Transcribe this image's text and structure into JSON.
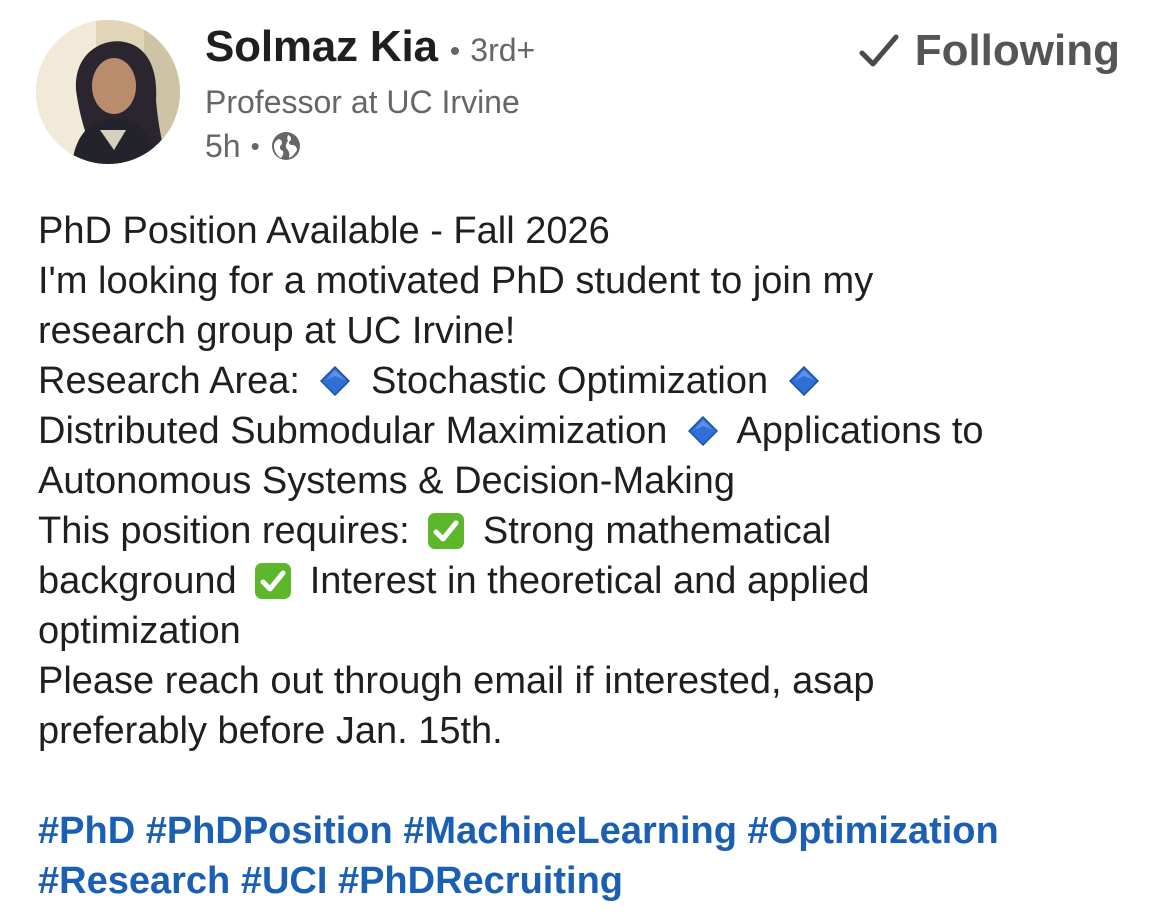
{
  "author": {
    "name": "Solmaz Kia",
    "degree": "3rd+",
    "headline": "Professor at UC Irvine",
    "posted_ago": "5h",
    "visibility_icon": "globe-icon"
  },
  "follow_button": {
    "label": "Following",
    "icon": "checkmark-icon"
  },
  "post": {
    "title": "PhD Position Available - Fall 2026",
    "intro_line1": "I'm looking for a motivated PhD student to join my",
    "intro_line2": "research group at UC Irvine!",
    "research_label": "Research Area:",
    "area1": "Stochastic Optimization",
    "area2": "Distributed Submodular Maximization",
    "area3_part1": "Applications to",
    "area3_part2": "Autonomous Systems & Decision-Making",
    "requires_label": "This position requires:",
    "req1_part1": "Strong mathematical",
    "req1_part2": "background",
    "req2_part1": "Interest in theoretical and applied",
    "req2_part2": "optimization",
    "contact_line1": "Please reach out through email if interested, asap",
    "contact_line2": "preferably before Jan. 15th."
  },
  "hashtags": [
    "#PhD",
    "#PhDPosition",
    "#MachineLearning",
    "#Optimization",
    "#Research",
    "#UCI",
    "#PhDRecruiting"
  ],
  "colors": {
    "hashtag": "#1a5fb4",
    "secondary_text": "#666666",
    "diamond": "#2f6fd6",
    "checkbox": "#5cb82a"
  }
}
